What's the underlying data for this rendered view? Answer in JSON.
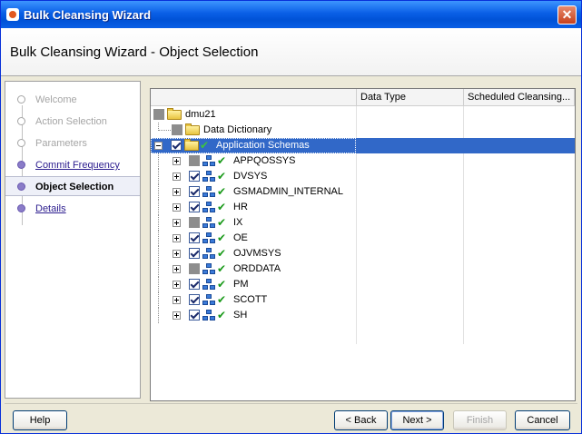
{
  "window": {
    "title": "Bulk Cleansing Wizard",
    "close_glyph": "✕"
  },
  "header": {
    "title": "Bulk Cleansing Wizard - Object Selection"
  },
  "nav": {
    "items": [
      {
        "label": "Welcome",
        "state": "done"
      },
      {
        "label": "Action Selection",
        "state": "done"
      },
      {
        "label": "Parameters",
        "state": "done"
      },
      {
        "label": "Commit Frequency",
        "state": "link"
      },
      {
        "label": "Object Selection",
        "state": "current"
      },
      {
        "label": "Details",
        "state": "link"
      }
    ]
  },
  "table": {
    "columns": [
      "",
      "Data Type",
      "Scheduled Cleansing..."
    ],
    "root": "dmu21",
    "data_dictionary": "Data Dictionary",
    "app_schemas": "Application Schemas",
    "schemas": [
      {
        "name": "APPQOSSYS",
        "checked": false
      },
      {
        "name": "DVSYS",
        "checked": true
      },
      {
        "name": "GSMADMIN_INTERNAL",
        "checked": true
      },
      {
        "name": "HR",
        "checked": true
      },
      {
        "name": "IX",
        "checked": false
      },
      {
        "name": "OE",
        "checked": true
      },
      {
        "name": "OJVMSYS",
        "checked": true
      },
      {
        "name": "ORDDATA",
        "checked": false
      },
      {
        "name": "PM",
        "checked": true
      },
      {
        "name": "SCOTT",
        "checked": true
      },
      {
        "name": "SH",
        "checked": true
      }
    ]
  },
  "buttons": {
    "help": "Help",
    "back": "< Back",
    "next": "Next >",
    "finish": "Finish",
    "cancel": "Cancel"
  },
  "colors": {
    "title_bar": "#0a5fe6",
    "selection": "#3168c8",
    "link": "#2b1c8e",
    "check_tick": "#1a9a1a"
  }
}
